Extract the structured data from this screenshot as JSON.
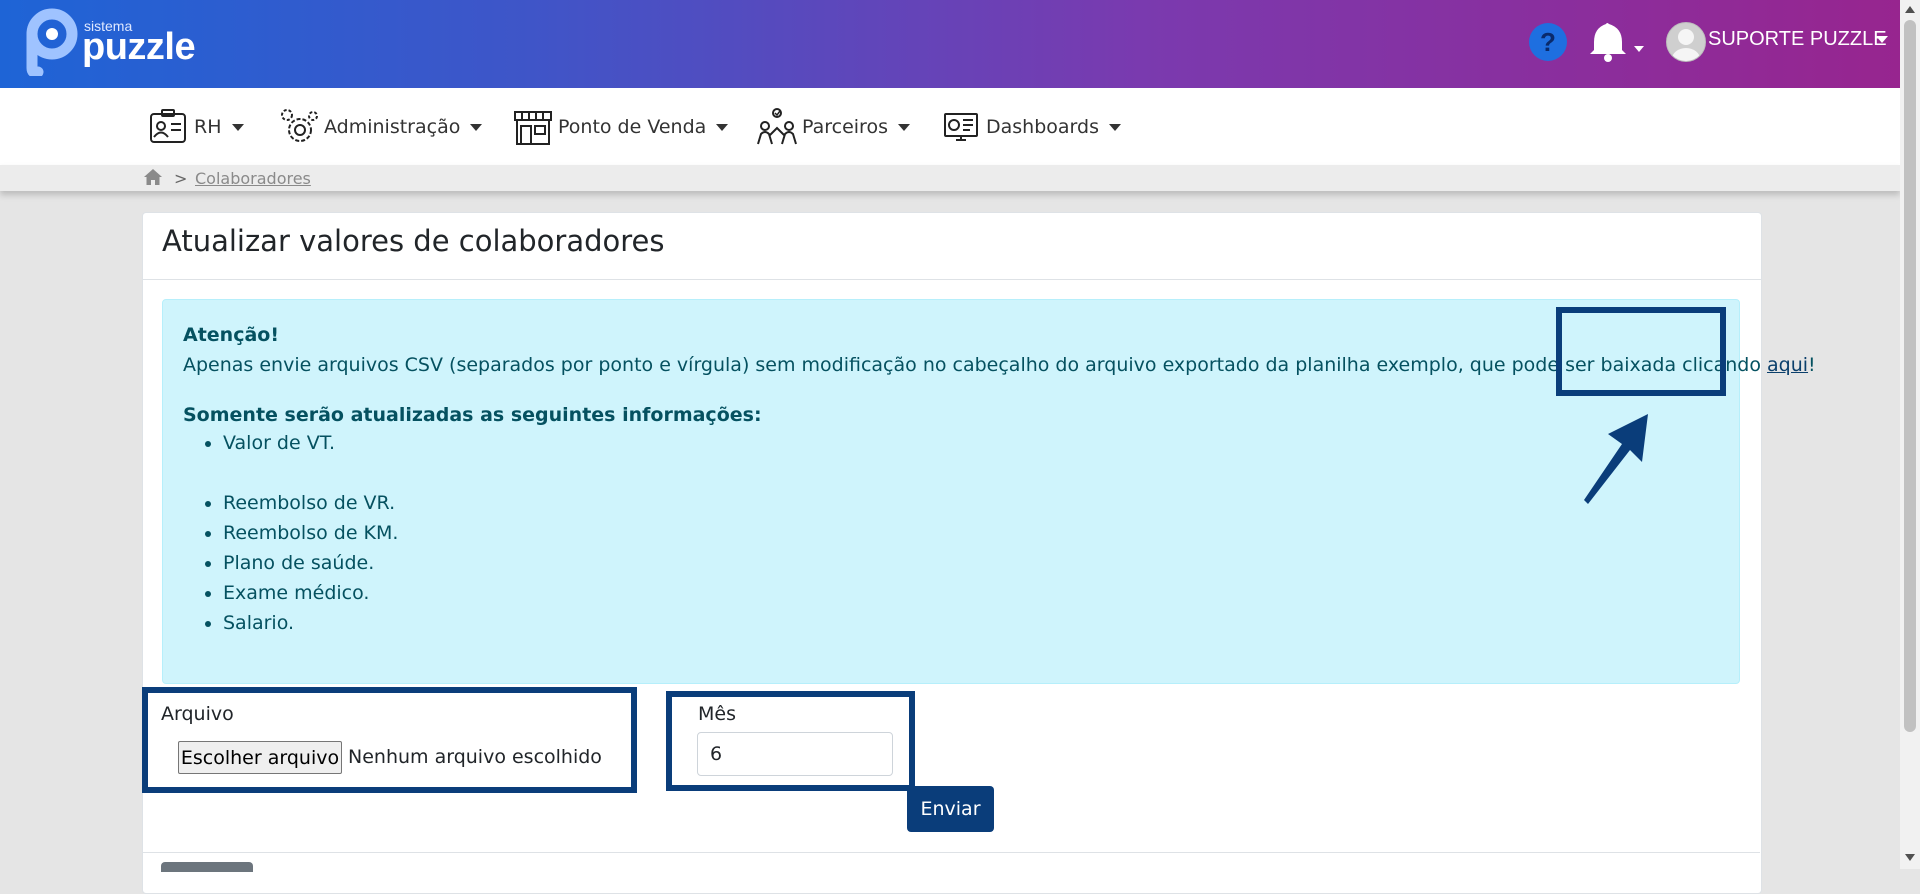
{
  "brand": {
    "small": "sistema",
    "name": "puzzle"
  },
  "header": {
    "user_name": "SUPORTE PUZZLE"
  },
  "nav": {
    "items": [
      {
        "label": "RH",
        "icon": "id-card-icon"
      },
      {
        "label": "Administração",
        "icon": "gears-icon"
      },
      {
        "label": "Ponto de Venda",
        "icon": "store-icon"
      },
      {
        "label": "Parceiros",
        "icon": "partners-icon"
      },
      {
        "label": "Dashboards",
        "icon": "monitor-chart-icon"
      }
    ]
  },
  "breadcrumb": {
    "separator": ">",
    "current": "Colaboradores"
  },
  "page": {
    "title": "Atualizar valores de colaboradores"
  },
  "alert": {
    "heading": "Atenção!",
    "text_before_link": "Apenas envie arquivos CSV (separados por ponto e vírgula) sem modificação no cabeçalho do arquivo exportado da planilha exemplo, que pode ser baixada clicando ",
    "link_text": "aqui",
    "text_after_link": "!",
    "list_heading": "Somente serão atualizadas as seguintes informações:",
    "items": [
      "Valor de VT.",
      "",
      "Reembolso de VR.",
      "Reembolso de KM.",
      "Plano de saúde.",
      "Exame médico.",
      "Salario."
    ]
  },
  "form": {
    "file_label": "Arquivo",
    "file_button": "Escolher arquivo",
    "file_status": "Nenhum arquivo escolhido",
    "month_label": "Mês",
    "month_value": "6",
    "submit_label": "Enviar"
  },
  "colors": {
    "accent": "#0a3d7a",
    "alert_bg": "#cff4fc",
    "alert_text": "#055160",
    "help": "#1e6fe0"
  }
}
